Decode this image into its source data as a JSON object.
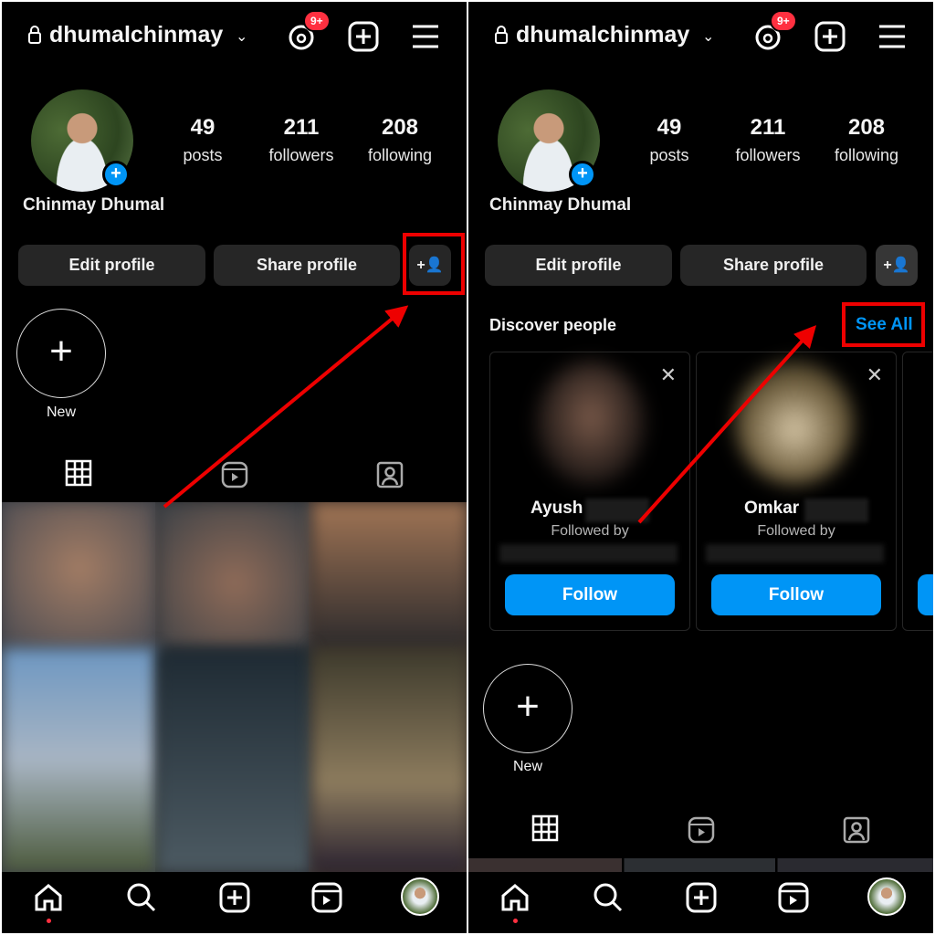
{
  "profile": {
    "username": "dhumalchinmay",
    "display_name": "Chinmay Dhumal",
    "notification_badge": "9+",
    "stats": [
      {
        "value": "49",
        "label": "posts"
      },
      {
        "value": "211",
        "label": "followers"
      },
      {
        "value": "208",
        "label": "following"
      }
    ]
  },
  "buttons": {
    "edit_profile": "Edit profile",
    "share_profile": "Share profile"
  },
  "highlights": {
    "new_label": "New"
  },
  "discover": {
    "title": "Discover people",
    "see_all": "See All",
    "cards": [
      {
        "name": "Ayush",
        "subtitle": "Followed by",
        "follow": "Follow"
      },
      {
        "name": "Omkar",
        "subtitle": "Followed by",
        "follow": "Follow"
      }
    ]
  },
  "icons": {
    "header": [
      "lock-icon",
      "chevron-down-icon",
      "threads-icon",
      "create-icon",
      "menu-icon"
    ],
    "tabs": [
      "grid-icon",
      "reels-icon",
      "tagged-icon"
    ],
    "nav": [
      "home-icon",
      "search-icon",
      "create-icon",
      "reels-icon",
      "profile-avatar"
    ]
  },
  "colors": {
    "background": "#000000",
    "accent": "#0095f6",
    "badge": "#ff3040",
    "highlight": "#e00000",
    "button": "#262626"
  }
}
